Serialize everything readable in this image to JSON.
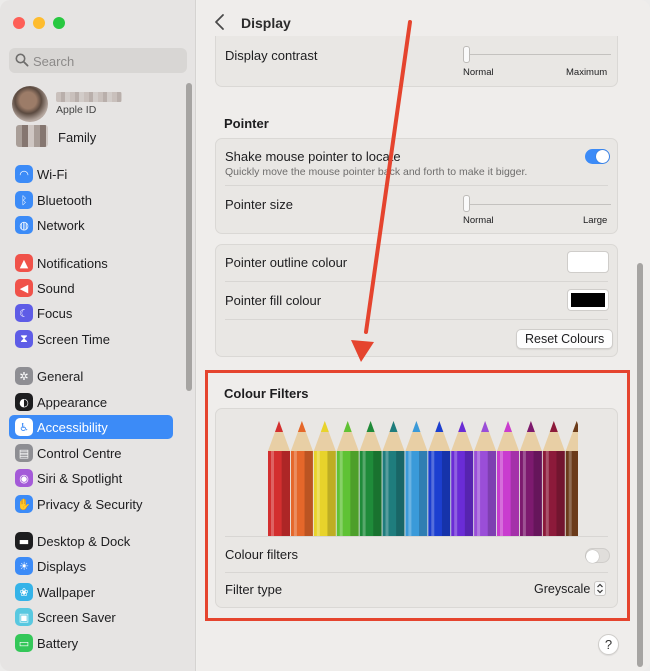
{
  "sidebar": {
    "search_placeholder": "Search",
    "apple_id_label": "Apple ID",
    "family_label": "Family",
    "items": [
      {
        "label": "Wi-Fi",
        "icon": "wifi-icon",
        "color": "#3c8bf7"
      },
      {
        "label": "Bluetooth",
        "icon": "bluetooth-icon",
        "color": "#3c8bf7"
      },
      {
        "label": "Network",
        "icon": "globe-icon",
        "color": "#3c8bf7"
      },
      {
        "label": "Notifications",
        "icon": "bell-icon",
        "color": "#f0524a"
      },
      {
        "label": "Sound",
        "icon": "speaker-icon",
        "color": "#f0524a"
      },
      {
        "label": "Focus",
        "icon": "moon-icon",
        "color": "#5e5ce6"
      },
      {
        "label": "Screen Time",
        "icon": "hourglass-icon",
        "color": "#5e5ce6"
      },
      {
        "label": "General",
        "icon": "gear-icon",
        "color": "#8e8e93"
      },
      {
        "label": "Appearance",
        "icon": "appearance-icon",
        "color": "#1d1d1f"
      },
      {
        "label": "Accessibility",
        "icon": "accessibility-icon",
        "color": "#3c8bf7",
        "selected": true
      },
      {
        "label": "Control Centre",
        "icon": "control-centre-icon",
        "color": "#8e8e93"
      },
      {
        "label": "Siri & Spotlight",
        "icon": "siri-icon",
        "color": "#a45ad8"
      },
      {
        "label": "Privacy & Security",
        "icon": "hand-icon",
        "color": "#3c8bf7"
      },
      {
        "label": "Desktop & Dock",
        "icon": "dock-icon",
        "color": "#1d1d1f"
      },
      {
        "label": "Displays",
        "icon": "sun-icon",
        "color": "#3c8bf7"
      },
      {
        "label": "Wallpaper",
        "icon": "wallpaper-icon",
        "color": "#35b3e8"
      },
      {
        "label": "Screen Saver",
        "icon": "screen-saver-icon",
        "color": "#58c8e0"
      },
      {
        "label": "Battery",
        "icon": "battery-icon",
        "color": "#34c759"
      }
    ]
  },
  "header": {
    "title": "Display"
  },
  "contrast": {
    "label": "Display contrast",
    "min_label": "Normal",
    "max_label": "Maximum",
    "value": 0
  },
  "pointer": {
    "heading": "Pointer",
    "shake_label": "Shake mouse pointer to locate",
    "shake_desc": "Quickly move the mouse pointer back and forth to make it bigger.",
    "shake_on": true,
    "size_label": "Pointer size",
    "size_min": "Normal",
    "size_max": "Large",
    "size_value": 0,
    "outline_label": "Pointer outline colour",
    "outline_color": "#ffffff",
    "fill_label": "Pointer fill colour",
    "fill_color": "#000000",
    "reset_label": "Reset Colours"
  },
  "filters": {
    "heading": "Colour Filters",
    "pencil_colors": [
      "#d32f2f",
      "#e5672a",
      "#e8d32b",
      "#5fc234",
      "#1f8b3a",
      "#1f7d7d",
      "#3a9ad9",
      "#1c3fd0",
      "#6a2cd6",
      "#9a4ed8",
      "#c93ccf",
      "#7d1a6f",
      "#8c1a3a",
      "#6b3b1a"
    ],
    "toggle_label": "Colour filters",
    "enabled": false,
    "type_label": "Filter type",
    "type_value": "Greyscale"
  },
  "help_label": "?",
  "annotation_color": "#e5442e"
}
